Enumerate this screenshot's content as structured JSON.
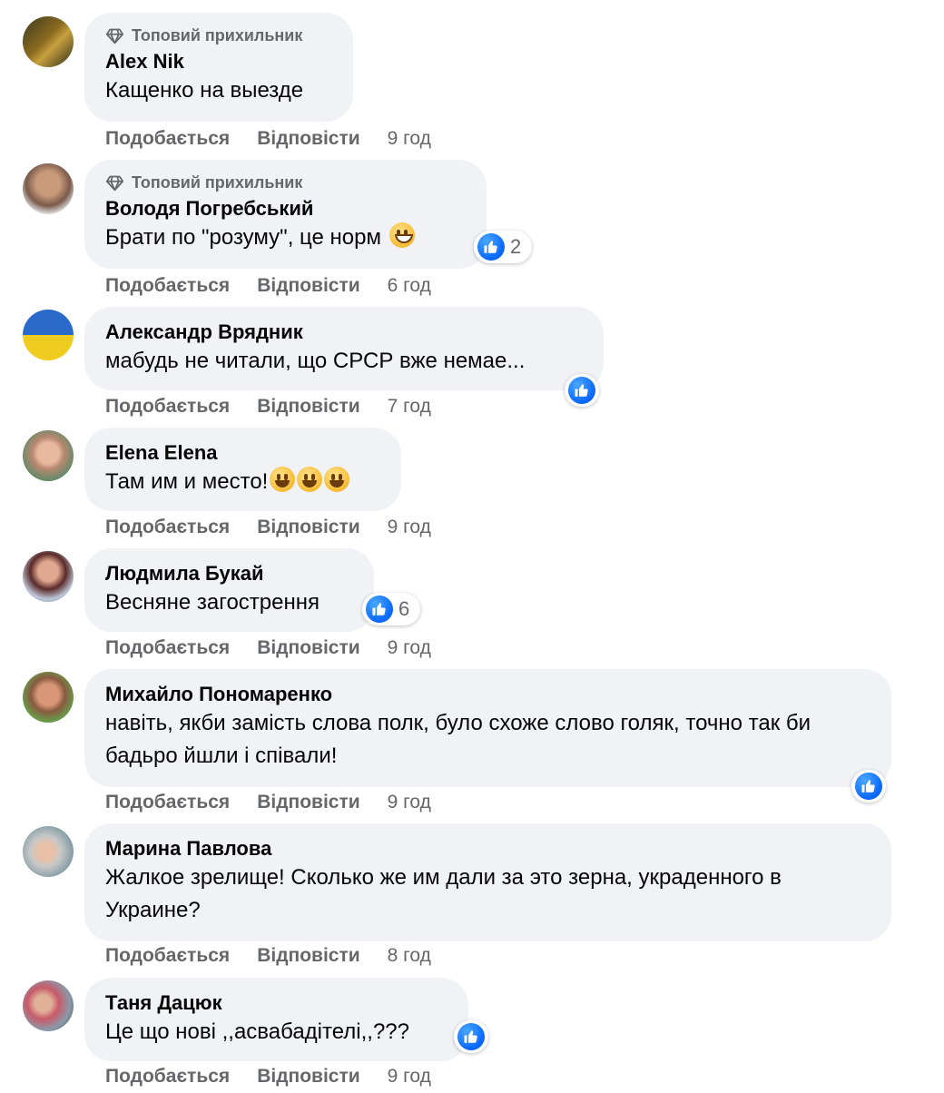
{
  "labels": {
    "top_fan": "Топовий прихильник",
    "like": "Подобається",
    "reply": "Відповісти"
  },
  "icons": {
    "top_fan": "diamond-icon",
    "reaction": "thumbs-up-icon",
    "emoji_smile": "grinning-face-emoji",
    "emoji_grin": "beaming-face-emoji"
  },
  "colors": {
    "bubble": "#f0f2f5",
    "secondary_text": "#65676b",
    "like_blue": "#0866ff"
  },
  "comments": [
    {
      "author": "Alex Nik",
      "text": "Кащенко на выезде",
      "time": "9 год",
      "top_fan": true,
      "reactions": null
    },
    {
      "author": "Володя Погребський",
      "text": "Брати по \"розуму\", це норм",
      "time": "6 год",
      "top_fan": true,
      "reactions": "2"
    },
    {
      "author": "Александр Врядник",
      "text": "мабудь не читали, що СРСР вже немае...",
      "time": "7 год",
      "top_fan": false,
      "reactions": ""
    },
    {
      "author": "Elena Elena",
      "text": "Там им и место!",
      "time": "9 год",
      "top_fan": false,
      "reactions": null
    },
    {
      "author": "Людмила Букай",
      "text": "Весняне загострення",
      "time": "9 год",
      "top_fan": false,
      "reactions": "6"
    },
    {
      "author": "Михайло Пономаренко",
      "text": "навіть, якби замість слова полк, було схоже слово голяк, точно так би бадьро йшли і співали!",
      "time": "9 год",
      "top_fan": false,
      "reactions": ""
    },
    {
      "author": "Марина Павлова",
      "text": "Жалкое зрелище! Сколько же им дали за это зерна, украденного в Украине?",
      "time": "8 год",
      "top_fan": false,
      "reactions": null
    },
    {
      "author": "Таня Дацюк",
      "text": "Це що нові ,,асвабадітелі,,???",
      "time": "9 год",
      "top_fan": false,
      "reactions": ""
    }
  ]
}
